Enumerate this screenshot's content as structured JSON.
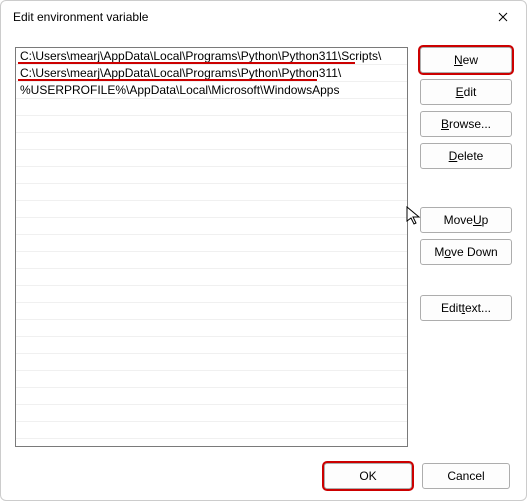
{
  "title": "Edit environment variable",
  "entries": [
    "C:\\Users\\mearj\\AppData\\Local\\Programs\\Python\\Python311\\Scripts\\",
    "C:\\Users\\mearj\\AppData\\Local\\Programs\\Python\\Python311\\",
    "%USERPROFILE%\\AppData\\Local\\Microsoft\\WindowsApps"
  ],
  "buttons": {
    "new_prefix": "N",
    "new_rest": "ew",
    "edit_prefix": "E",
    "edit_rest": "dit",
    "browse_prefix": "B",
    "browse_rest": "rowse...",
    "delete_prefix": "D",
    "delete_rest": "elete",
    "moveup_prefix": "Move ",
    "moveup_mid": "U",
    "moveup_rest": "p",
    "movedown_prefix": "M",
    "movedown_mid": "o",
    "movedown_rest": "ve Down",
    "edittext_prefix": "Edit ",
    "edittext_mid": "t",
    "edittext_rest": "ext...",
    "ok": "OK",
    "cancel": "Cancel"
  }
}
